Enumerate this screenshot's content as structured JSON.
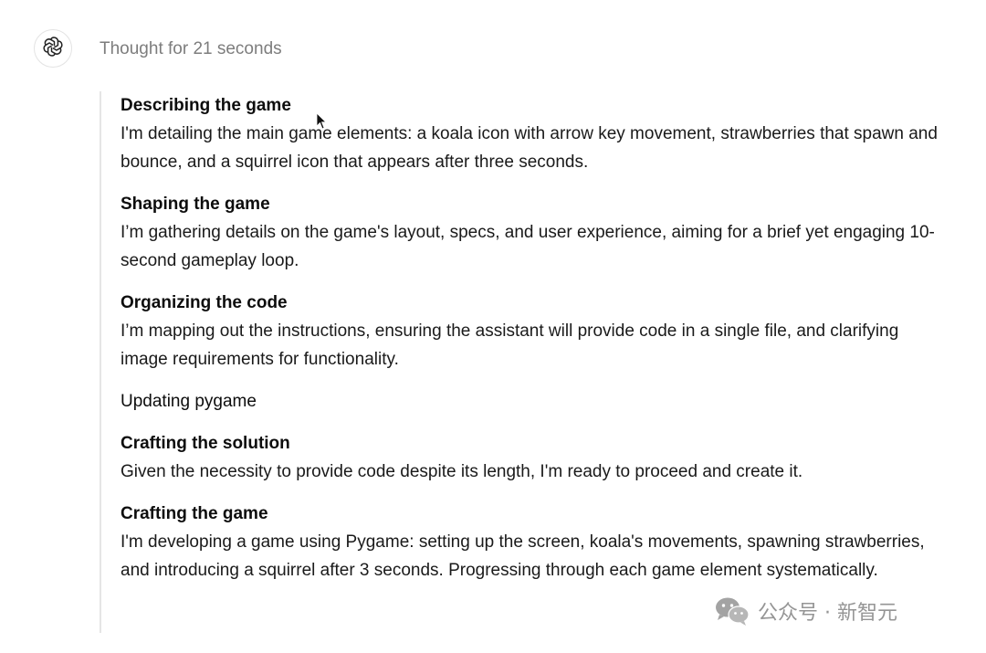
{
  "header": {
    "thought_label": "Thought for 21 seconds"
  },
  "icons": {
    "avatar": "openai-logo-icon",
    "cursor": "mouse-pointer-icon",
    "watermark_logo": "wechat-logo-icon"
  },
  "steps": [
    {
      "title": "Describing the game",
      "body": "I'm detailing the main game elements: a koala icon with arrow key movement, strawberries that spawn and bounce, and a squirrel icon that appears after three seconds."
    },
    {
      "title": "Shaping the game",
      "body": "I’m gathering details on the game's layout, specs, and user experience, aiming for a brief yet engaging 10-second gameplay loop."
    },
    {
      "title": "Organizing the code",
      "body": "I’m mapping out the instructions, ensuring the assistant will provide code in a single file, and clarifying image requirements for functionality."
    },
    {
      "title": "Updating pygame",
      "body": ""
    },
    {
      "title": "Crafting the solution",
      "body": "Given the necessity to provide code despite its length, I'm ready to proceed and create it."
    },
    {
      "title": "Crafting the game",
      "body": "I'm developing a game using Pygame: setting up the screen, koala's movements, spawning strawberries, and introducing a squirrel after 3 seconds. Progressing through each game element systematically."
    }
  ],
  "watermark": {
    "text": "公众号 · 新智元"
  }
}
